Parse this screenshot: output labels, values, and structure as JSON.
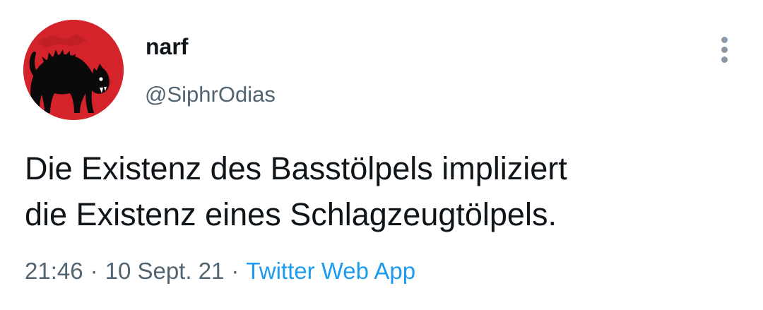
{
  "user": {
    "display_name": "narf",
    "handle": "@SiphrOdias",
    "avatar_icon": "black-cat-avatar-icon"
  },
  "tweet": {
    "text_lines": [
      "Die Existenz des Basstölpels impliziert",
      "die Existenz eines Schlagzeugtölpels."
    ],
    "time": "21:46",
    "separator": "·",
    "date": "10 Sept. 21",
    "source": "Twitter Web App"
  },
  "actions": {
    "more_icon": "more-vertical-icon"
  },
  "colors": {
    "text_primary": "#0f1419",
    "text_secondary": "#536471",
    "link": "#1d9bf0",
    "avatar_background": "#d4232a",
    "more_icon": "#8b98a5"
  }
}
